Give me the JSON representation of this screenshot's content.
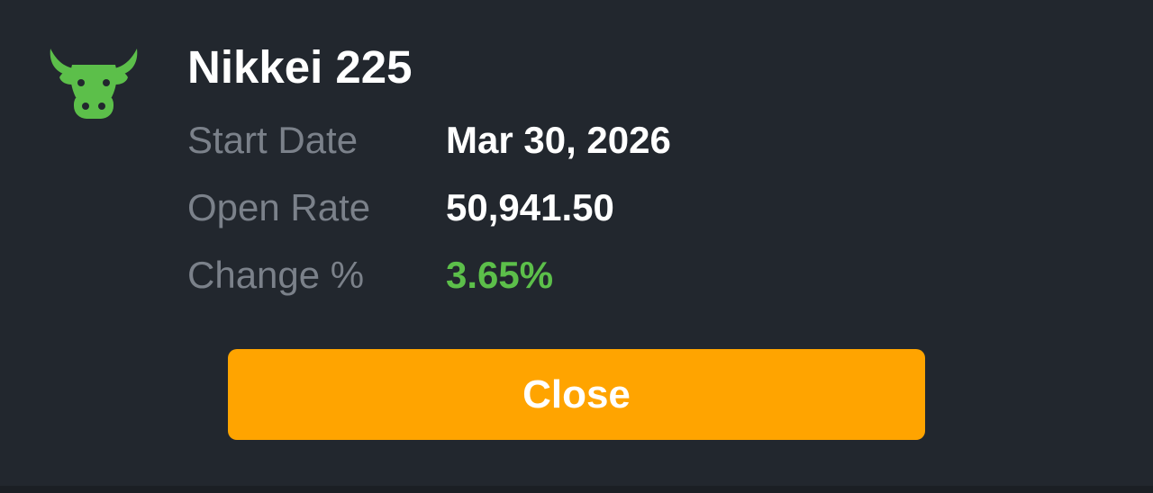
{
  "dialog": {
    "icon": "bull-icon",
    "title": "Nikkei 225",
    "rows": [
      {
        "label": "Start Date",
        "value": "Mar 30, 2026"
      },
      {
        "label": "Open Rate",
        "value": "50,941.50"
      },
      {
        "label": "Change %",
        "value": "3.65%"
      }
    ],
    "close_label": "Close"
  },
  "colors": {
    "background": "#22272e",
    "label": "#7b818a",
    "value": "#ffffff",
    "positive": "#5cbf4a",
    "icon": "#5cbf4a",
    "button": "#ffa400"
  }
}
